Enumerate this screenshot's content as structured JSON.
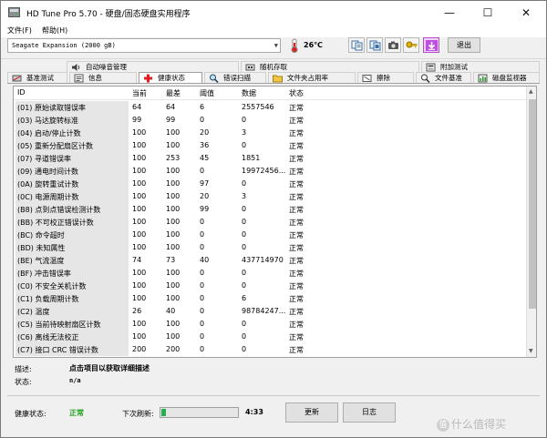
{
  "window": {
    "title": "HD Tune Pro 5.70 - 硬盘/固态硬盘实用程序",
    "minimize_glyph": "—",
    "maximize_glyph": "☐",
    "close_glyph": "✕"
  },
  "menu": {
    "file": "文件(F)",
    "help": "帮助(H)"
  },
  "toolbar": {
    "drive": "Seagate Expansion (2000 gB)",
    "temperature": "26℃",
    "exit_label": "退出",
    "icons": [
      "copy-text-icon",
      "copy-screen-icon",
      "camera-icon",
      "key-icon",
      "download-icon"
    ]
  },
  "tabs": {
    "row1": [
      "自动噪音管理",
      "随机存取",
      "附加测试"
    ],
    "row2": [
      "基准测试",
      "信息",
      "健康状态",
      "错误扫描",
      "文件夹占用率",
      "擦除",
      "文件基准",
      "磁盘监视器"
    ]
  },
  "table": {
    "headers": {
      "id": "ID",
      "current": "当前",
      "worst": "最差",
      "threshold": "阈值",
      "data": "数据",
      "status": "状态"
    },
    "rows": [
      {
        "id": "(01) 原始读取错误率",
        "current": "64",
        "worst": "64",
        "threshold": "6",
        "data": "2557546",
        "status": "正常"
      },
      {
        "id": "(03) 马达旋转标准",
        "current": "99",
        "worst": "99",
        "threshold": "0",
        "data": "0",
        "status": "正常"
      },
      {
        "id": "(04) 启动/停止计数",
        "current": "100",
        "worst": "100",
        "threshold": "20",
        "data": "3",
        "status": "正常"
      },
      {
        "id": "(05) 重新分配扇区计数",
        "current": "100",
        "worst": "100",
        "threshold": "36",
        "data": "0",
        "status": "正常"
      },
      {
        "id": "(07) 寻道错误率",
        "current": "100",
        "worst": "253",
        "threshold": "45",
        "data": "1851",
        "status": "正常"
      },
      {
        "id": "(09) 通电时间计数",
        "current": "100",
        "worst": "100",
        "threshold": "0",
        "data": "19972456...",
        "status": "正常"
      },
      {
        "id": "(0A) 旋转重试计数",
        "current": "100",
        "worst": "100",
        "threshold": "97",
        "data": "0",
        "status": "正常"
      },
      {
        "id": "(0C) 电源周期计数",
        "current": "100",
        "worst": "100",
        "threshold": "20",
        "data": "3",
        "status": "正常"
      },
      {
        "id": "(B8) 点到点错误检测计数",
        "current": "100",
        "worst": "100",
        "threshold": "99",
        "data": "0",
        "status": "正常"
      },
      {
        "id": "(BB) 不可校正错误计数",
        "current": "100",
        "worst": "100",
        "threshold": "0",
        "data": "0",
        "status": "正常"
      },
      {
        "id": "(BC) 命令超时",
        "current": "100",
        "worst": "100",
        "threshold": "0",
        "data": "0",
        "status": "正常"
      },
      {
        "id": "(BD) 未知属性",
        "current": "100",
        "worst": "100",
        "threshold": "0",
        "data": "0",
        "status": "正常"
      },
      {
        "id": "(BE) 气流温度",
        "current": "74",
        "worst": "73",
        "threshold": "40",
        "data": "437714970",
        "status": "正常"
      },
      {
        "id": "(BF) 冲击错误率",
        "current": "100",
        "worst": "100",
        "threshold": "0",
        "data": "0",
        "status": "正常"
      },
      {
        "id": "(C0) 不安全关机计数",
        "current": "100",
        "worst": "100",
        "threshold": "0",
        "data": "0",
        "status": "正常"
      },
      {
        "id": "(C1) 负载周期计数",
        "current": "100",
        "worst": "100",
        "threshold": "0",
        "data": "6",
        "status": "正常"
      },
      {
        "id": "(C2) 温度",
        "current": "26",
        "worst": "40",
        "threshold": "0",
        "data": "98784247...",
        "status": "正常"
      },
      {
        "id": "(C5) 当前待映射扇区计数",
        "current": "100",
        "worst": "100",
        "threshold": "0",
        "data": "0",
        "status": "正常"
      },
      {
        "id": "(C6) 离线无法校正",
        "current": "100",
        "worst": "100",
        "threshold": "0",
        "data": "0",
        "status": "正常"
      },
      {
        "id": "(C7) 接口 CRC 错误计数",
        "current": "200",
        "worst": "200",
        "threshold": "0",
        "data": "0",
        "status": "正常"
      }
    ]
  },
  "details": {
    "desc_label": "描述:",
    "desc_value": "点击项目以获取详细描述",
    "status_label": "状态:",
    "status_value": "n/a"
  },
  "footer": {
    "health_label": "健康状态:",
    "health_value": "正常",
    "health_color": "#1ea21e",
    "next_refresh_label": "下次刷新:",
    "refresh_progress": 0.06,
    "countdown": "4:33",
    "update_button": "更新",
    "log_button": "日志"
  },
  "watermark": {
    "badge": "值",
    "text": "什么值得买"
  }
}
